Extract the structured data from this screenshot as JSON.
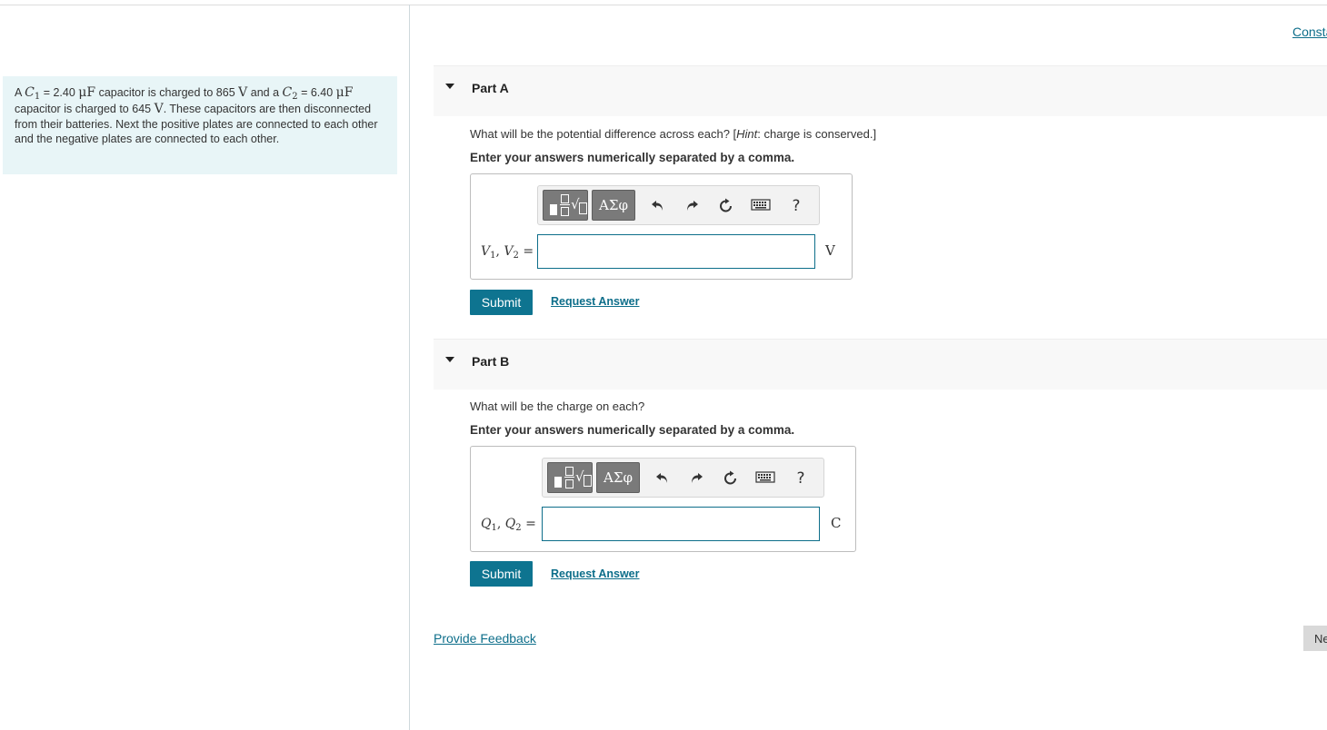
{
  "constants_link": "Consta",
  "problem": {
    "t1": "A ",
    "c1_var": "C",
    "c1_sub": "1",
    "c1_value": " = 2.40 ",
    "unit_uF": "μF",
    "t2": " capacitor is charged to 865 ",
    "unit_V": "V",
    "t3": " and a ",
    "c2_var": "C",
    "c2_sub": "2",
    "c2_value": " = 6.40 ",
    "t4": "capacitor is charged to 645 ",
    "t5": ". These capacitors are then disconnected from their batteries. Next the positive plates are connected to each other and the negative plates are connected to each other."
  },
  "toolbar": {
    "greek_label": "ΑΣφ",
    "help_label": "?",
    "icons": [
      "templates-icon",
      "greek-symbols-icon",
      "undo-icon",
      "redo-icon",
      "reset-icon",
      "keyboard-icon",
      "help-icon"
    ]
  },
  "part_a": {
    "title": "Part A",
    "question_pre": "What will be the potential difference across each? [",
    "question_hint": "Hint",
    "question_post": ": charge is conserved.]",
    "instruction": "Enter your answers numerically separated by a comma.",
    "var1": "V",
    "var1_sub": "1",
    "sep": ", ",
    "var2": "V",
    "var2_sub": "2",
    "eq": " =",
    "input_value": "",
    "unit": "V",
    "submit_label": "Submit",
    "request_label": "Request Answer"
  },
  "part_b": {
    "title": "Part B",
    "question": "What will be the charge on each?",
    "instruction": "Enter your answers numerically separated by a comma.",
    "var1": "Q",
    "var1_sub": "1",
    "sep": ", ",
    "var2": "Q",
    "var2_sub": "2",
    "eq": " =",
    "input_value": "",
    "unit": "C",
    "submit_label": "Submit",
    "request_label": "Request Answer"
  },
  "feedback_label": "Provide Feedback",
  "next_label": "Next",
  "colors": {
    "accent": "#0e7490",
    "link": "#0d6e8a",
    "problem_bg": "#e8f5f7"
  }
}
